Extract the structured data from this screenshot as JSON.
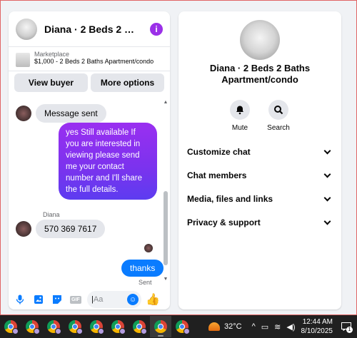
{
  "chat": {
    "title": "Diana · 2 Beds 2 Baths Apartment/condo",
    "marketplace": {
      "label": "Marketplace",
      "item": "$1,000 - 2 Beds 2 Baths Apartment/condo"
    },
    "buttons": {
      "view_buyer": "View buyer",
      "more_options": "More options"
    },
    "messages": {
      "msg1": "Message sent",
      "msg2": "yes Still available If you are interested in viewing please send me your contact number and I'll share the full details.",
      "sender_name": "Diana",
      "msg3": "570 369 7617",
      "msg4": "thanks",
      "status": "Sent"
    },
    "composer": {
      "placeholder": "Aa",
      "gif_label": "GIF"
    }
  },
  "info": {
    "title": "Diana · 2 Beds 2 Baths Apartment/condo",
    "actions": {
      "mute": "Mute",
      "search": "Search"
    },
    "sections": {
      "customize": "Customize chat",
      "members": "Chat members",
      "media": "Media, files and links",
      "privacy": "Privacy & support"
    }
  },
  "taskbar": {
    "temperature": "32°C",
    "time": "12:44 AM",
    "date": "8/10/2025",
    "notification_count": "1"
  },
  "colors": {
    "accent_blue": "#0a7cff",
    "bubble_purple": "#7a33ee",
    "info_icon": "#9b30e8",
    "taskbar": "#202020"
  }
}
